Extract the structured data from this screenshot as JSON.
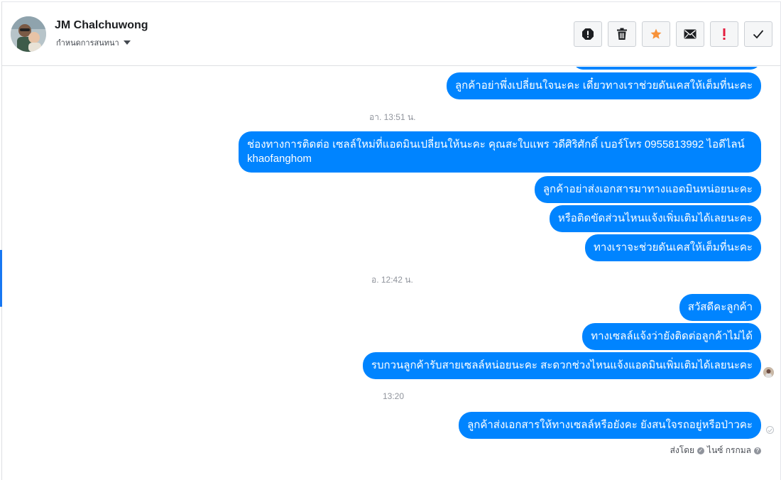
{
  "contact": {
    "name": "JM Chalchuwong",
    "setting_label": "กำหนดการสนทนา"
  },
  "toolbar": {
    "buttons": [
      {
        "icon": "spam-icon",
        "color": "#1c1e21"
      },
      {
        "icon": "trash-icon",
        "color": "#1c1e21"
      },
      {
        "icon": "star-icon",
        "color": "#f7923a"
      },
      {
        "icon": "mail-icon",
        "color": "#1c1e21"
      },
      {
        "icon": "important-icon",
        "color": "#e41e3f"
      },
      {
        "icon": "check-icon",
        "color": "#1c1e21"
      }
    ]
  },
  "colors": {
    "bubble": "#0084ff",
    "bubble_text": "#ffffff",
    "timestamp": "#90949c"
  },
  "thread": {
    "messages_1": [
      "ลูกค้าอย่าพึ่งเปลี่ยนใจนะคะ เดี๋ยวทางเราช่วยดันเคสให้เต็มที่นะคะ"
    ],
    "stamp_1": "อา. 13:51 น.",
    "messages_2": [
      "ช่องทางการติดต่อ เซลล์ใหม่ที่แอดมินเปลี่ยนให้นะคะ คุณสะใบแพร วดีศิริศักดิ์  เบอร์โทร 0955813992  ไอดีไลน์  khaofanghom",
      "ลูกค้าอย่าส่งเอกสารมาทางแอดมินหน่อยนะคะ",
      "หรือติดขัดส่วนไหนแจ้งเพิ่มเติมได้เลยนะคะ",
      "ทางเราจะช่วยดันเคสให้เต็มที่นะคะ"
    ],
    "stamp_2": "อ. 12:42 น.",
    "messages_3": [
      "สวัสดีคะลูกค้า",
      "ทางเซลล์แจ้งว่ายังติดต่อลูกค้าไม่ได้",
      "รบกวนลูกค้ารับสายเซลล์หน่อยนะคะ สะดวกช่วงไหนแจ้งแอดมินเพิ่มเติมได้เลยนะคะ"
    ],
    "stamp_3": "13:20",
    "messages_4": [
      "ลูกค้าส่งเอกสารให้ทางเซลล์หรือยังคะ ยังสนใจรถอยู่หรือป่าวคะ"
    ],
    "sent_by_label": "ส่งโดย",
    "sent_by_name": "ไนซ์ กรกมล"
  }
}
